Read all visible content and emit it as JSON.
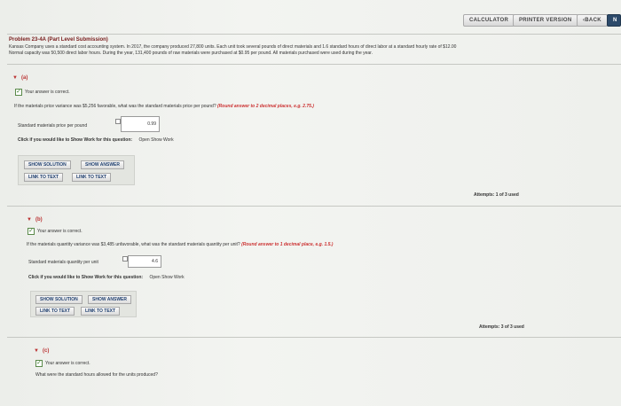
{
  "toolbar": {
    "calculator": "CALCULATOR",
    "printer_version": "PRINTER VERSION",
    "back": "‹BACK",
    "next": "N"
  },
  "problem": {
    "title": "Problem 23-4A (Part Level Submission)",
    "description_line1": "Kansas Company uses a standard cost accounting system. In 2017, the company produced 27,800 units. Each unit took several pounds of direct materials and 1.6 standard hours of direct labor at a standard hourly rate of $12.00",
    "description_line2": "Normal capacity was 50,500 direct labor hours. During the year, 131,400 pounds of raw materials were purchased at $0.95 per pound. All materials purchased were used during the year."
  },
  "part_a": {
    "label": "(a)",
    "correct_msg": "Your answer is correct.",
    "question": "If the materials price variance was $5,256 favorable, what was the standard materials price per pound?",
    "hint": "(Round answer to 2 decimal places, e.g. 2.75.)",
    "input_label": "Standard materials price per pound",
    "input_value": "0.99",
    "show_work_prompt": "Click if you would like to Show Work for this question:",
    "show_work_link": "Open Show Work",
    "show_solution": "SHOW SOLUTION",
    "show_answer": "SHOW ANSWER",
    "link_text_1": "LINK TO TEXT",
    "link_text_2": "LINK TO TEXT",
    "attempts": "Attempts: 1 of 3 used"
  },
  "part_b": {
    "label": "(b)",
    "correct_msg": "Your answer is correct.",
    "question": "If the materials quantity variance was $3,485 unfavorable, what was the standard materials quantity per unit?",
    "hint": "(Round answer to 1 decimal place, e.g. 1.5.)",
    "input_label": "Standard materials quantity per unit",
    "input_value": "4.6",
    "show_work_prompt": "Click if you would like to Show Work for this question:",
    "show_work_link": "Open Show Work",
    "show_solution": "SHOW SOLUTION",
    "show_answer": "SHOW ANSWER",
    "link_text_1": "LINK TO TEXT",
    "link_text_2": "LINK TO TEXT",
    "attempts": "Attempts: 3 of 3 used"
  },
  "part_c": {
    "label": "(c)",
    "correct_msg": "Your answer is correct.",
    "question": "What were the standard hours allowed for the units produced?"
  }
}
